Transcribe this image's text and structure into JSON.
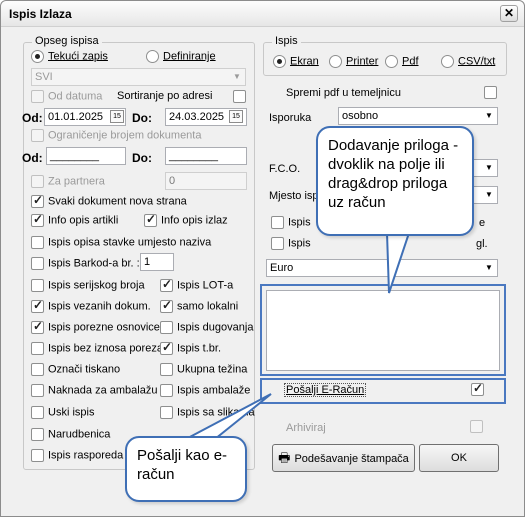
{
  "window": {
    "title": "Ispis Izlaza",
    "close_glyph": "✕"
  },
  "opseg": {
    "group_title": "Opseg ispisa",
    "radio_tekuci": "Tekući zapis",
    "radio_definiranje": "Definiranje",
    "svi_combo_value": "SVI",
    "od_datuma": "Od datuma",
    "sortiranje": "Sortiranje po adresi",
    "od_label": "Od:",
    "do_label": "Do:",
    "date_from": "01.01.2025",
    "date_to": "24.03.2025",
    "date_btn": "15",
    "ogranicenje": "Ograničenje brojem dokumenta",
    "od2_label": "Od:",
    "do2_label": "Do:",
    "od2_value": "________",
    "do2_value": "________",
    "za_partnera": "Za partnera",
    "za_partnera_value": "0",
    "svaki_dokument": "Svaki dokument nova strana",
    "info_opis_artikli": "Info opis artikli",
    "info_opis_izlaz": "Info opis izlaz",
    "ispis_opisa_stavke": "Ispis opisa stavke umjesto naziva",
    "ispis_barkod": "Ispis Barkod-a br. :",
    "barkod_value": "1",
    "ispis_serijskog": "Ispis serijskog broja",
    "ispis_lot": "Ispis LOT-a",
    "ispis_vezanih": "Ispis vezanih dokum.",
    "samo_lokalni": "samo lokalni",
    "ispis_porezne": "Ispis porezne osnovice",
    "ispis_dugovanja": "Ispis dugovanja",
    "ispis_bez_iznosa": "Ispis bez iznosa poreza",
    "ispis_tbr": "Ispis t.br.",
    "oznaci_tiskano": "Označi tiskano",
    "ukupna_tezina": "Ukupna težina",
    "naknada": "Naknada za ambalažu",
    "ispis_ambalaze": "Ispis ambalaže",
    "uski_ispis": "Uski ispis",
    "ispis_sa_slikama": "Ispis sa slikama",
    "narudbenica": "Narudbenica",
    "ispis_rasporeda": "Ispis rasporeda s"
  },
  "ispis": {
    "group_title": "Ispis",
    "radio_ekran": "Ekran",
    "radio_printer": "Printer",
    "radio_pdf": "Pdf",
    "radio_csv": "CSV/txt",
    "spremi_pdf": "Spremi pdf u temeljnicu",
    "isporuka_label": "Isporuka",
    "isporuka_value": "osobno",
    "fco_label": "F.C.O.",
    "mjesto_label": "Mjesto isp",
    "ispis_a": "Ispis",
    "ispis_a_tail": "e",
    "ispis_b": "Ispis",
    "ispis_b_tail": "gl.",
    "currency_value": "Euro",
    "posalji_eracun": "Pošalji E-Račun",
    "arhiviraj": "Arhiviraj",
    "podesavanje_btn": "Podešavanje štampača",
    "ok_btn": "OK"
  },
  "callouts": {
    "top": "Dodavanje priloga - dvoklik na polje ili drag&drop priloga uz račun",
    "bottom": "Pošalji kao e-račun"
  },
  "colors": {
    "callout_border": "#3f6fb5",
    "highlight_border": "#4a78c0"
  }
}
